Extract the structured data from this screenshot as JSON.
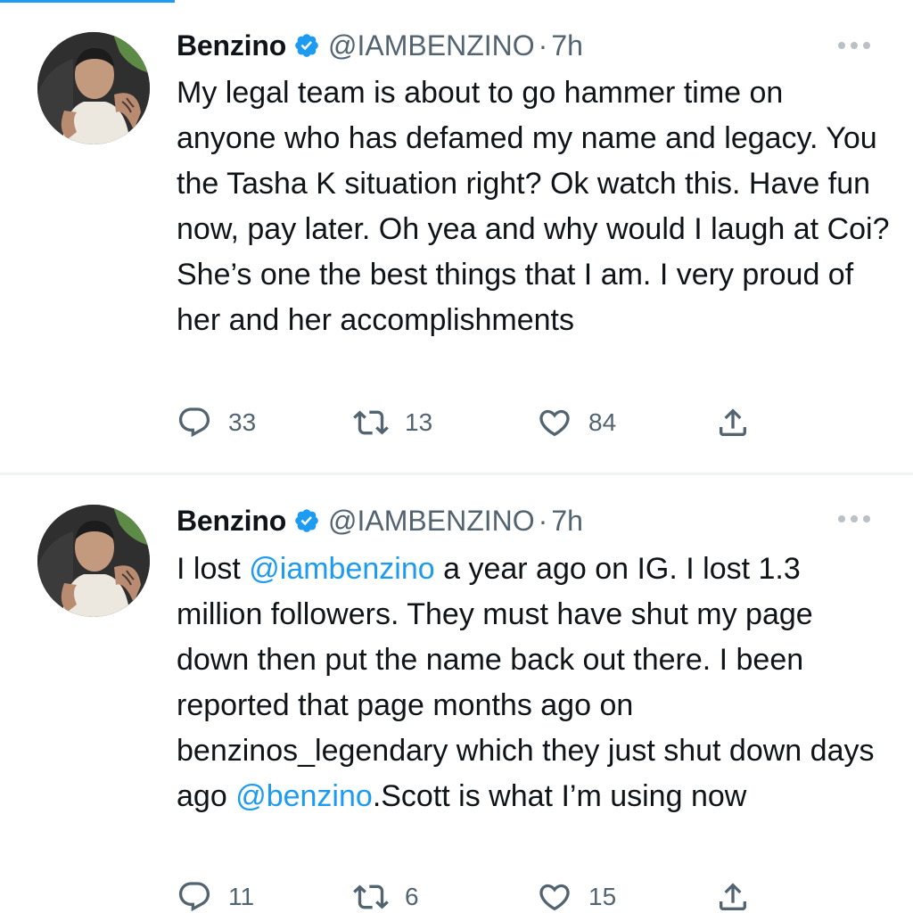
{
  "tweets": [
    {
      "name": "Benzino",
      "handle": "@IAMBENZINO",
      "separator": "·",
      "time": "7h",
      "text_parts": [
        {
          "type": "text",
          "value": "My legal team is about to go hammer time on anyone who has defamed my name and legacy. You the Tasha K situation right? Ok watch this. Have fun now, pay later. Oh yea and why would I laugh at Coi? She’s one the best things that I am. I very proud of her and her accomplishments"
        }
      ],
      "replies": "33",
      "retweets": "13",
      "likes": "84"
    },
    {
      "name": "Benzino",
      "handle": "@IAMBENZINO",
      "separator": "·",
      "time": "7h",
      "text_parts": [
        {
          "type": "text",
          "value": "I lost "
        },
        {
          "type": "mention",
          "value": "@iambenzino"
        },
        {
          "type": "text",
          "value": " a year ago on IG. I lost 1.3 million followers. They must have shut my page down then put the name back out there. I been reported that page months ago on benzinos_legendary which they just shut down days ago "
        },
        {
          "type": "mention",
          "value": "@benzino"
        },
        {
          "type": "text",
          "value": ".Scott is what I’m using now"
        }
      ],
      "replies": "11",
      "retweets": "6",
      "likes": "15"
    }
  ],
  "colors": {
    "accent": "#1d9bf0",
    "text": "#0f1419",
    "secondary": "#536471",
    "divider": "#eff3f4"
  },
  "icons": [
    "verified-badge-icon",
    "more-options-icon",
    "reply-icon",
    "retweet-icon",
    "like-icon",
    "share-icon"
  ]
}
